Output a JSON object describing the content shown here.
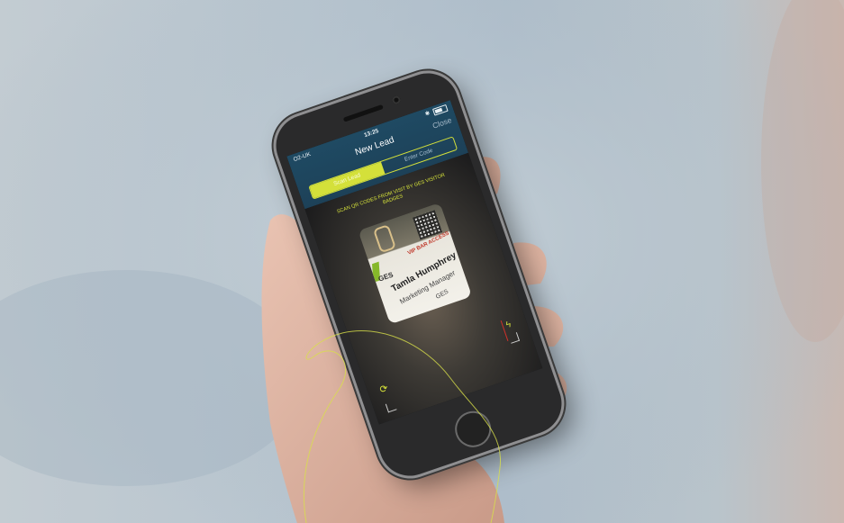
{
  "status_bar": {
    "carrier": "O2-UK",
    "time": "13:25"
  },
  "nav": {
    "title": "New Lead",
    "close_label": "Close"
  },
  "tabs": [
    {
      "label": "Scan Lead",
      "active": true
    },
    {
      "label": "Enter Code",
      "active": false
    }
  ],
  "instruction": "SCAN QR CODES FROM VISIT BY GES VISITOR BADGES",
  "badge": {
    "brand": "GES",
    "access": "VIP BAR ACCESS",
    "name": "Tamla Humphrey",
    "role_line1": "Marketing Manager",
    "role_line2": "GES"
  },
  "icons": {
    "flash": "flash-off-icon",
    "switch_camera": "switch-camera-icon"
  },
  "colors": {
    "accent": "#d4e03a",
    "header": "#1f4a63"
  }
}
